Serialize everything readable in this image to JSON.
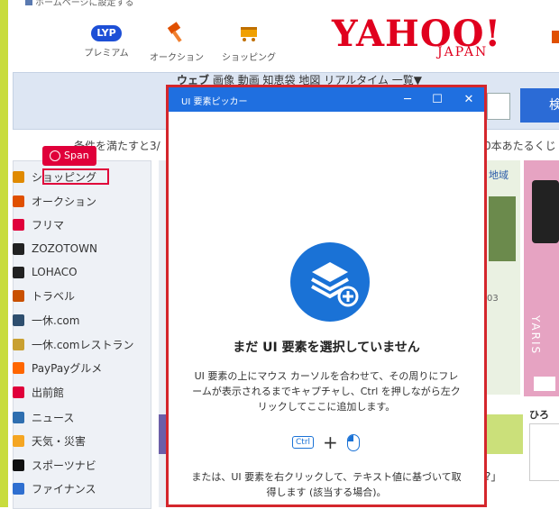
{
  "topbar": {
    "text": "ホームページに設定する"
  },
  "services": [
    {
      "icon": "lyp-badge",
      "badge": "LYP",
      "label": "プレミアム"
    },
    {
      "icon": "gavel-icon",
      "label": "オークション"
    },
    {
      "icon": "cart-icon",
      "label": "ショッピング"
    }
  ],
  "logo": {
    "main": "YAHOO!",
    "sub": "JAPAN"
  },
  "search": {
    "tabs": [
      "ウェブ",
      "画像",
      "動画",
      "知恵袋",
      "地図",
      "リアルタイム",
      "一覧▼"
    ],
    "button": "検"
  },
  "notice": {
    "left": "…条件を満たすと3/",
    "right": "0本あたるくじ"
  },
  "span_tag": {
    "label": "Span"
  },
  "sidebar": {
    "items": [
      {
        "label": "ショッピング",
        "icon": "cart-icon",
        "color": "#e08a00"
      },
      {
        "label": "オークション",
        "icon": "gavel-icon",
        "color": "#e05000"
      },
      {
        "label": "フリマ",
        "icon": "tent-icon",
        "color": "#e0003a"
      },
      {
        "label": "ZOZOTOWN",
        "icon": "zozo-icon",
        "color": "#222222"
      },
      {
        "label": "LOHACO",
        "icon": "lohaco-icon",
        "color": "#222222"
      },
      {
        "label": "トラベル",
        "icon": "suitcase-icon",
        "color": "#c95000"
      },
      {
        "label": "一休.com",
        "icon": "ikyu-icon",
        "color": "#2f4f6f"
      },
      {
        "label": "一休.comレストラン",
        "icon": "ikyu-restaurant-icon",
        "color": "#c9a030"
      },
      {
        "label": "PayPayグルメ",
        "icon": "gourmet-icon",
        "color": "#ff6600"
      },
      {
        "label": "出前館",
        "icon": "demaekan-icon",
        "color": "#e0003a"
      },
      {
        "label": "ニュース",
        "icon": "news-icon",
        "color": "#2f6fb0"
      },
      {
        "label": "天気・災害",
        "icon": "weather-icon",
        "color": "#f5a623"
      },
      {
        "label": "スポーツナビ",
        "icon": "sports-icon",
        "color": "#111111"
      },
      {
        "label": "ファイナンス",
        "icon": "finance-icon",
        "color": "#2f6fd0"
      }
    ]
  },
  "right": {
    "region_tab": "地域",
    "date": "03",
    "pink_vertical": "YARIS",
    "hiro": "ひろ",
    "quote": "?」"
  },
  "dialog": {
    "title": "UI 要素ピッカー",
    "heading": "まだ UI 要素を選択していません",
    "body": "UI 要素の上にマウス カーソルを合わせて、その周りにフレームが表示されるまでキャプチャし、Ctrl を押しながら左クリックしてここに追加します。",
    "ctrl_key": "Ctrl",
    "plus": "+",
    "footer": "または、UI 要素を右クリックして、テキスト値に基づいて取得します (該当する場合)。"
  }
}
